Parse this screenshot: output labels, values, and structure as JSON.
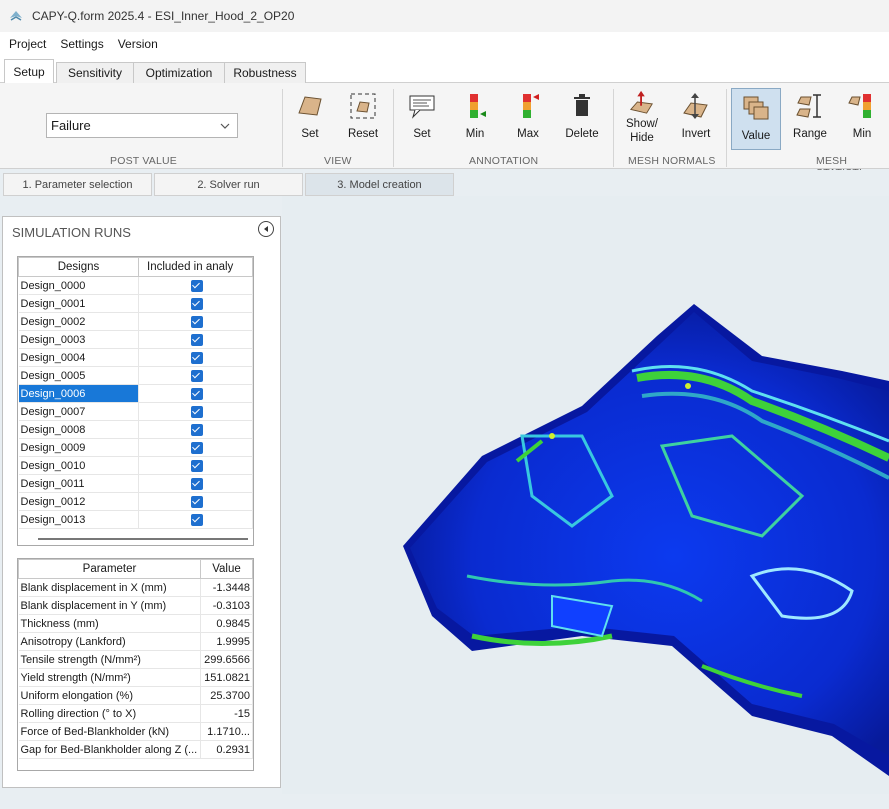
{
  "window": {
    "title": "CAPY-Q.form 2025.4 - ESI_Inner_Hood_2_OP20"
  },
  "menu": [
    "Project",
    "Settings",
    "Version"
  ],
  "tabs": [
    "Setup",
    "Sensitivity",
    "Optimization",
    "Robustness"
  ],
  "ribbon": {
    "post_value": {
      "selected": "Failure",
      "group": "POST VALUE"
    },
    "view": {
      "group": "VIEW",
      "set": "Set",
      "reset": "Reset"
    },
    "annotation": {
      "group": "ANNOTATION",
      "set": "Set",
      "min": "Min",
      "max": "Max",
      "delete": "Delete"
    },
    "mesh_normals": {
      "group": "MESH NORMALS",
      "show_hide_1": "Show/",
      "show_hide_2": "Hide",
      "invert": "Invert"
    },
    "mesh_statistics": {
      "group": "MESH STATISTI",
      "value": "Value",
      "range": "Range",
      "min": "Min"
    }
  },
  "steps": [
    "1. Parameter selection",
    "2. Solver run",
    "3. Model creation"
  ],
  "simulation_runs": {
    "title": "SIMULATION RUNS",
    "columns": [
      "Designs",
      "Included in analy"
    ],
    "rows": [
      "Design_0000",
      "Design_0001",
      "Design_0002",
      "Design_0003",
      "Design_0004",
      "Design_0005",
      "Design_0006",
      "Design_0007",
      "Design_0008",
      "Design_0009",
      "Design_0010",
      "Design_0011",
      "Design_0012",
      "Design_0013"
    ],
    "selected": "Design_0006"
  },
  "parameters": {
    "columns": [
      "Parameter",
      "Value"
    ],
    "rows": [
      {
        "name": "Blank displacement in X (mm)",
        "value": "-1.3448"
      },
      {
        "name": "Blank displacement in Y (mm)",
        "value": "-0.3103"
      },
      {
        "name": "Thickness (mm)",
        "value": "0.9845"
      },
      {
        "name": "Anisotropy (Lankford)",
        "value": "1.9995"
      },
      {
        "name": "Tensile strength (N/mm²)",
        "value": "299.6566"
      },
      {
        "name": "Yield strength (N/mm²)",
        "value": "151.0821"
      },
      {
        "name": "Uniform elongation (%)",
        "value": "25.3700"
      },
      {
        "name": "Rolling direction (° to X)",
        "value": "-15"
      },
      {
        "name": "Force of Bed-Blankholder (kN)",
        "value": "1.1710..."
      },
      {
        "name": "Gap for Bed-Blankholder along Z (...",
        "value": "0.2931"
      }
    ]
  },
  "colors": {
    "selection": "#1878d8",
    "checkbox": "#1e6fcf",
    "mesh_blue": "#0a2fd8",
    "mesh_green": "#3ed23a"
  }
}
